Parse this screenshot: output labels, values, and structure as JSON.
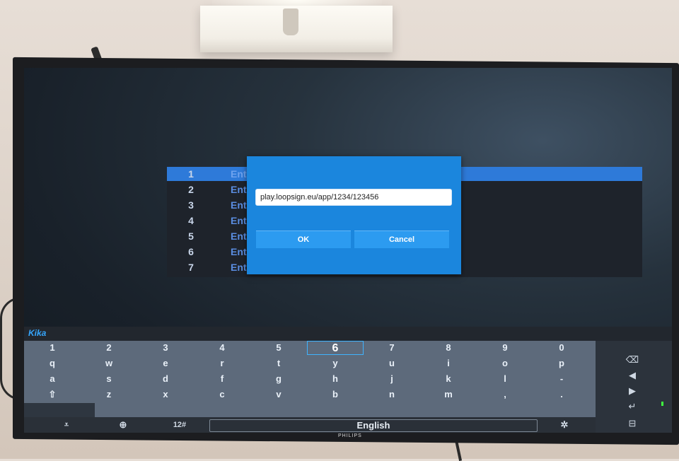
{
  "tv_brand": "PHILIPS",
  "list": {
    "rows": [
      {
        "num": "1",
        "text": "Ente"
      },
      {
        "num": "2",
        "text": "Ente"
      },
      {
        "num": "3",
        "text": "Ente"
      },
      {
        "num": "4",
        "text": "Ente"
      },
      {
        "num": "5",
        "text": "Ente"
      },
      {
        "num": "6",
        "text": "Ente"
      },
      {
        "num": "7",
        "text": "Ente"
      }
    ]
  },
  "dialog": {
    "input_value": "play.loopsign.eu/app/1234/123456",
    "ok_label": "OK",
    "cancel_label": "Cancel"
  },
  "keyboard": {
    "brand": "Kika",
    "row_numbers": [
      "1",
      "2",
      "3",
      "4",
      "5",
      "6",
      "7",
      "8",
      "9",
      "0"
    ],
    "row_q": [
      "q",
      "w",
      "e",
      "r",
      "t",
      "y",
      "u",
      "i",
      "o",
      "p"
    ],
    "row_a": [
      "a",
      "s",
      "d",
      "f",
      "g",
      "h",
      "j",
      "k",
      "l",
      "-"
    ],
    "row_z": [
      "⇧",
      "z",
      "x",
      "c",
      "v",
      "b",
      "n",
      "m",
      ",",
      "."
    ],
    "selected_key": "6",
    "bottom": {
      "collapse": "⩡",
      "globe": "⊕",
      "numbers": "12#",
      "space_label": "English",
      "settings": "✲"
    },
    "side": {
      "backspace": "⌫",
      "left": "◀",
      "right": "▶",
      "enter": "↵",
      "emoji": "⊟"
    }
  },
  "colors": {
    "accent": "#1b86dd",
    "selection": "#2e7ad9",
    "kika_brand": "#35a7ff"
  }
}
